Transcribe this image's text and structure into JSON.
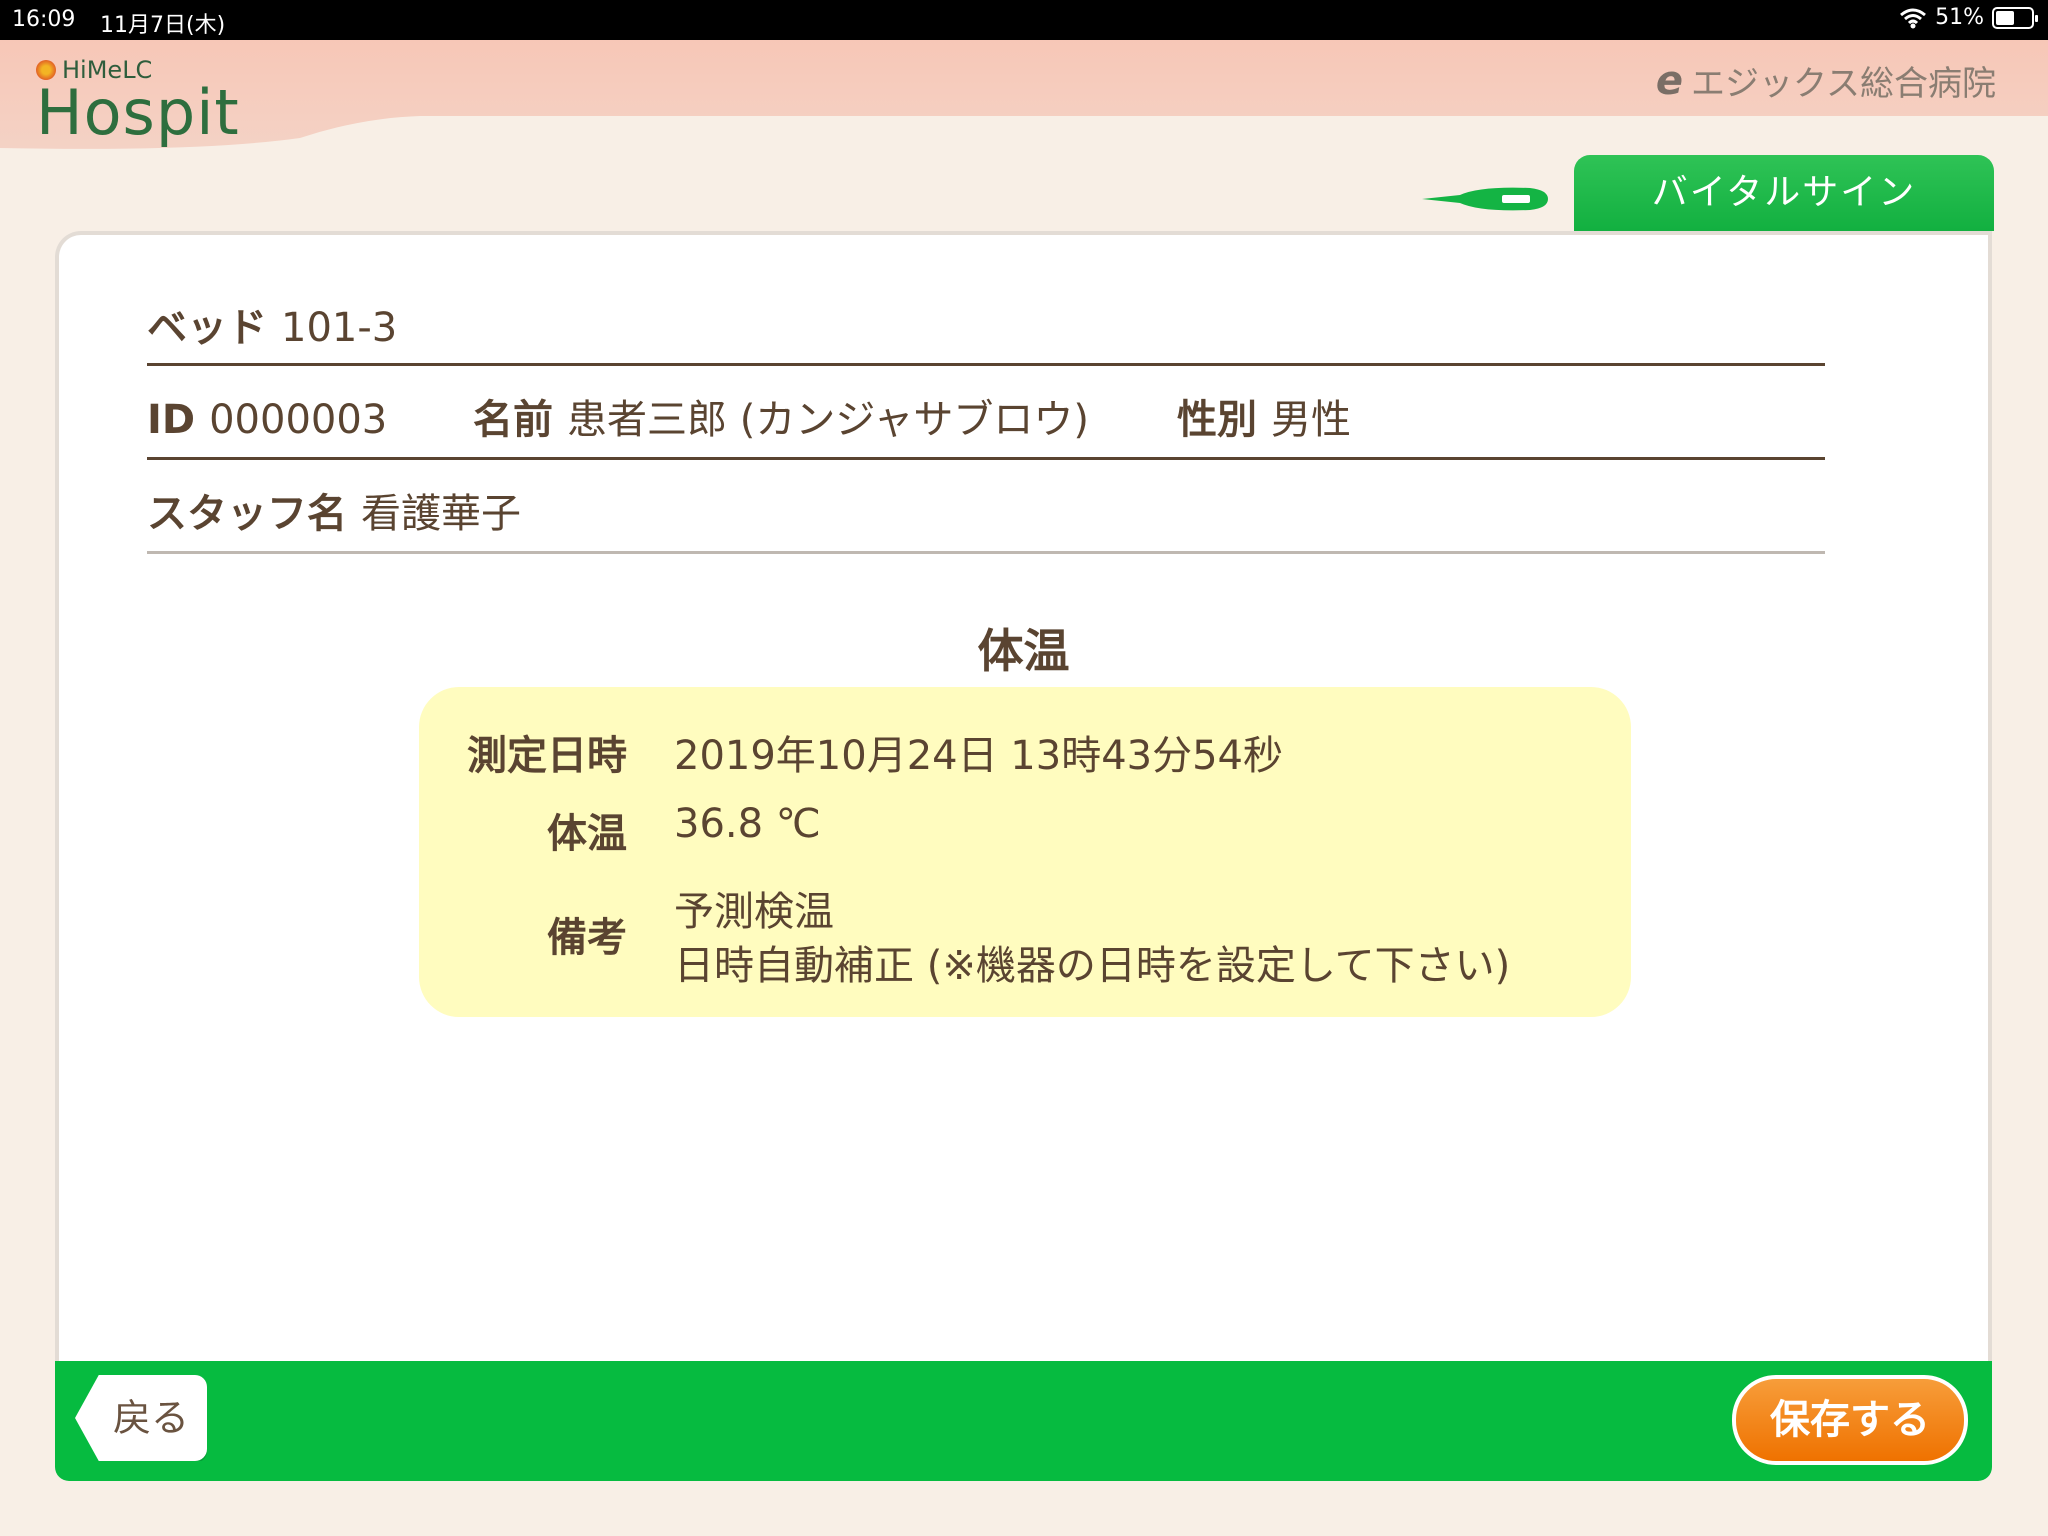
{
  "status": {
    "time": "16:09",
    "date": "11月7日(木)",
    "battery": "51%"
  },
  "header": {
    "brand_small": "HiMeLC",
    "brand_big": "Hospit",
    "hospital": "エジックス総合病院"
  },
  "tab": {
    "label": "バイタルサイン"
  },
  "patient": {
    "bed_label": "ベッド",
    "bed_value": "101-3",
    "id_label": "ID",
    "id_value": "0000003",
    "name_label": "名前",
    "name_value": "患者三郎 (カンジャサブロウ)",
    "sex_label": "性別",
    "sex_value": "男性",
    "staff_label": "スタッフ名",
    "staff_value": "看護華子"
  },
  "measurement": {
    "title": "体温",
    "datetime_label": "測定日時",
    "datetime_value": "2019年10月24日 13時43分54秒",
    "temp_label": "体温",
    "temp_value": "36.8 ℃",
    "note_label": "備考",
    "note_line1": "予測検温",
    "note_line2": "日時自動補正 (※機器の日時を設定して下さい)"
  },
  "footer": {
    "back_label": "戻る",
    "save_label": "保存する"
  },
  "colors": {
    "accent_green": "#06bb40",
    "save_orange": "#ef7200",
    "info_bg": "#fffcbf"
  }
}
